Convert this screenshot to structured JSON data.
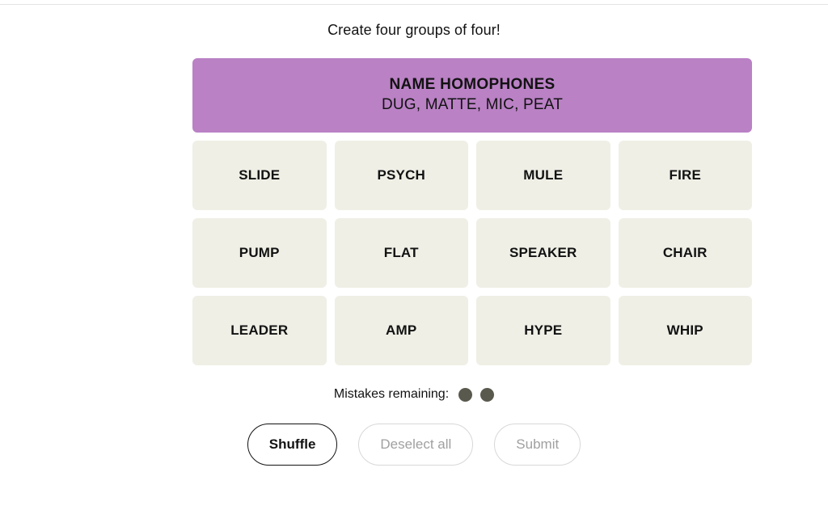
{
  "colors": {
    "purple_group": "#ba81c5",
    "tile_bg": "#efefe6",
    "text": "#121212",
    "dot": "#5a594e",
    "disabled_text": "#a0a0a0",
    "disabled_border": "#d8d8d8"
  },
  "header": {
    "instruction": "Create four groups of four!"
  },
  "solved_groups": [
    {
      "title": "NAME HOMOPHONES",
      "members": "DUG, MATTE, MIC, PEAT",
      "color": "#ba81c5",
      "difficulty": "purple"
    }
  ],
  "grid": {
    "rows": [
      [
        "SLIDE",
        "PSYCH",
        "MULE",
        "FIRE"
      ],
      [
        "PUMP",
        "FLAT",
        "SPEAKER",
        "CHAIR"
      ],
      [
        "LEADER",
        "AMP",
        "HYPE",
        "WHIP"
      ]
    ]
  },
  "mistakes": {
    "label": "Mistakes remaining:",
    "remaining": 2,
    "dots": [
      "dot",
      "dot"
    ]
  },
  "actions": {
    "shuffle": {
      "label": "Shuffle",
      "enabled": true
    },
    "deselect": {
      "label": "Deselect all",
      "enabled": false
    },
    "submit": {
      "label": "Submit",
      "enabled": false
    }
  }
}
